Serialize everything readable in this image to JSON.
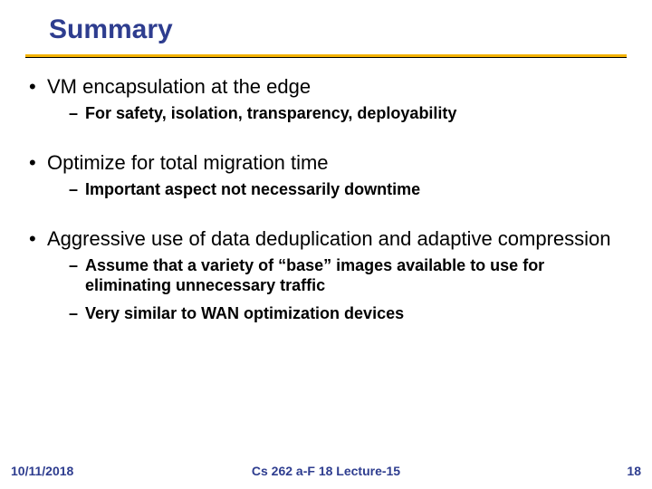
{
  "title": "Summary",
  "bullets": [
    {
      "text": "VM encapsulation at the edge",
      "subs": [
        "For safety, isolation, transparency, deployability"
      ]
    },
    {
      "text": "Optimize for total migration time",
      "subs": [
        "Important aspect not necessarily downtime"
      ]
    },
    {
      "text": "Aggressive use of data deduplication and adaptive compression",
      "subs": [
        "Assume that a variety of “base” images available to use for eliminating unnecessary traffic",
        "Very similar to WAN optimization devices"
      ]
    }
  ],
  "footer": {
    "date": "10/11/2018",
    "center": "Cs 262 a-F 18 Lecture-15",
    "page": "18"
  }
}
